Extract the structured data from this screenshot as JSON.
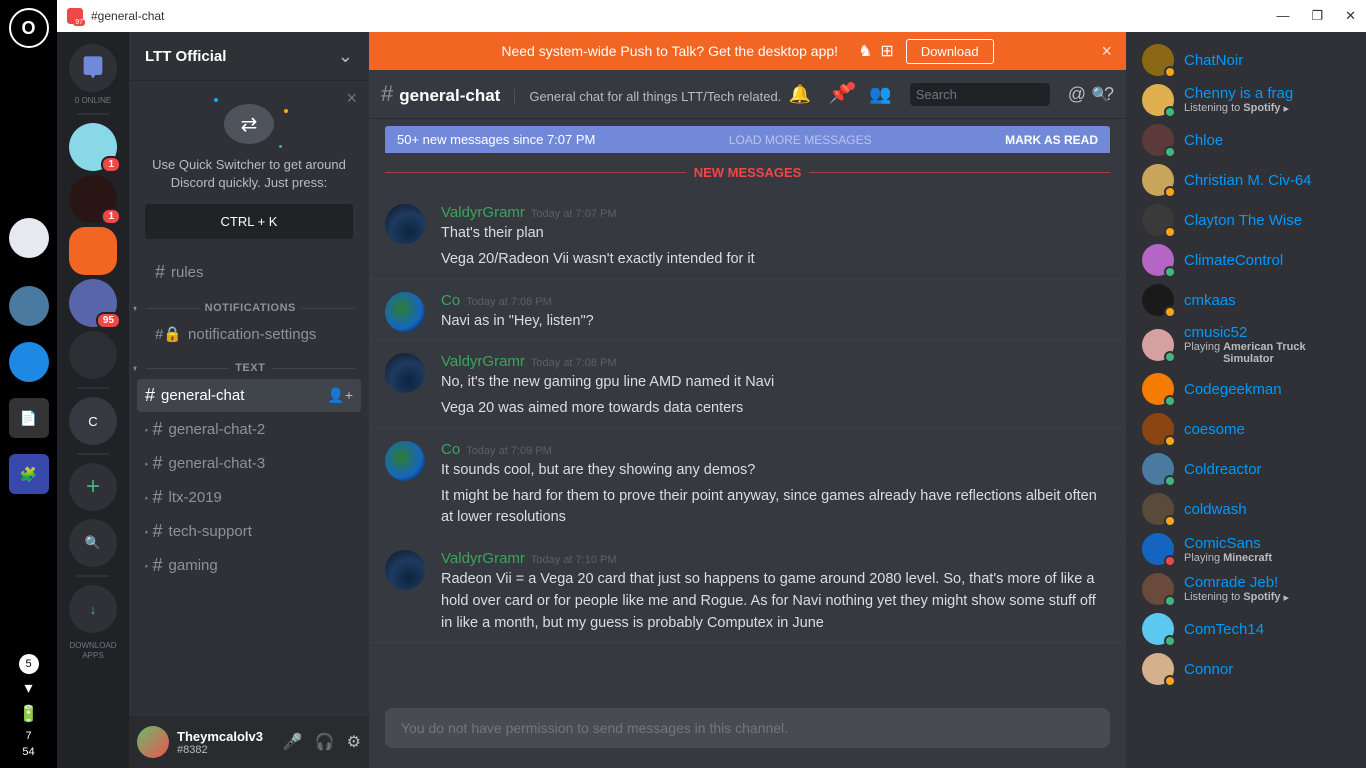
{
  "titlebar": {
    "text": "#general-chat",
    "badge": "97"
  },
  "os": {
    "stat1": "7",
    "stat2": "54",
    "badge5": "5"
  },
  "servers": {
    "online_label": "0 ONLINE",
    "download_label": "DOWNLOAD\nAPPS",
    "items": [
      {
        "badge": "1",
        "bg": "#88d8e8"
      },
      {
        "badge": "1",
        "bg": "#2a1515"
      },
      {
        "badge": "",
        "bg": "#f26522",
        "active": true
      },
      {
        "badge": "95",
        "bg": "#5865a8"
      },
      {
        "badge": "",
        "bg": "#36393f",
        "dim": true
      }
    ],
    "user_letter": "C"
  },
  "sidebar": {
    "server_name": "LTT Official",
    "qs": {
      "text": "Use Quick Switcher to get around Discord quickly. Just press:",
      "button": "CTRL + K"
    },
    "cat_rules": "rules",
    "cat_notifications_label": "NOTIFICATIONS",
    "notif_settings": "notification-settings",
    "cat_text_label": "TEXT",
    "channels": [
      {
        "name": "general-chat",
        "active": true
      },
      {
        "name": "general-chat-2"
      },
      {
        "name": "general-chat-3"
      },
      {
        "name": "ltx-2019"
      },
      {
        "name": "tech-support"
      },
      {
        "name": "gaming"
      }
    ]
  },
  "user": {
    "name": "Theymcalolv3",
    "tag": "#8382"
  },
  "banner": {
    "text": "Need system-wide Push to Talk? Get the desktop app!",
    "button": "Download"
  },
  "chat": {
    "title": "general-chat",
    "topic": "General chat for all things LTT/Tech related.",
    "search_placeholder": "Search",
    "new_bar": "50+ new messages since 7:07 PM",
    "load_more": "LOAD MORE MESSAGES",
    "mark_read": "MARK AS READ",
    "new_messages": "NEW MESSAGES",
    "input_placeholder": "You do not have permission to send messages in this channel."
  },
  "messages": [
    {
      "author": "ValdyrGramr",
      "color": "#3ba55c",
      "time": "Today at 7:07 PM",
      "avatar": "av-blue",
      "lines": [
        "That's their plan",
        "Vega 20/Radeon Vii wasn't exactly intended for it"
      ]
    },
    {
      "author": "Co",
      "color": "#3ba55c",
      "time": "Today at 7:08 PM",
      "avatar": "av-earth",
      "lines": [
        "Navi as in \"Hey, listen\"?"
      ]
    },
    {
      "author": "ValdyrGramr",
      "color": "#3ba55c",
      "time": "Today at 7:08 PM",
      "avatar": "av-blue",
      "lines": [
        "No, it's the new gaming gpu line AMD named it Navi",
        "Vega 20 was aimed more towards data centers"
      ]
    },
    {
      "author": "Co",
      "color": "#3ba55c",
      "time": "Today at 7:09 PM",
      "avatar": "av-earth",
      "lines": [
        "It sounds cool, but are they showing any demos?",
        "It might be hard for them to prove their point anyway, since games already have reflections albeit often at lower resolutions"
      ]
    },
    {
      "author": "ValdyrGramr",
      "color": "#3ba55c",
      "time": "Today at 7:10 PM",
      "avatar": "av-blue",
      "lines": [
        "Radeon Vii = a Vega 20 card that just so happens to game around 2080 level.  So, that's more of like a hold over card or for people like me and Rogue.  As for Navi nothing yet they might show some stuff off in like a month, but my guess is probably Computex in June"
      ]
    }
  ],
  "members": [
    {
      "name": "ChatNoir",
      "bg": "#8b6914",
      "status": "idle"
    },
    {
      "name": "Chenny is a frag",
      "bg": "#e0b050",
      "status": "online",
      "activity_prefix": "Listening to",
      "activity_name": "Spotify",
      "spotify": true
    },
    {
      "name": "Chloe",
      "bg": "#5d3a3a",
      "status": "online"
    },
    {
      "name": "Christian M. Civ-64",
      "bg": "#c9a55c",
      "status": "idle"
    },
    {
      "name": "Clayton The Wise",
      "bg": "#3a3a3a",
      "status": "idle"
    },
    {
      "name": "ClimateControl",
      "bg": "#b565c4",
      "status": "online"
    },
    {
      "name": "cmkaas",
      "bg": "#1a1a1a",
      "status": "idle"
    },
    {
      "name": "cmusic52",
      "bg": "#d4a0a0",
      "status": "online",
      "activity_prefix": "Playing",
      "activity_name": "American Truck Simulator"
    },
    {
      "name": "Codegeekman",
      "bg": "#f57c00",
      "status": "online"
    },
    {
      "name": "coesome",
      "bg": "#8b4513",
      "status": "idle"
    },
    {
      "name": "Coldreactor",
      "bg": "#4a7aa0",
      "status": "online"
    },
    {
      "name": "coldwash",
      "bg": "#5a4a3a",
      "status": "idle"
    },
    {
      "name": "ComicSans",
      "bg": "#1565c0",
      "status": "dnd",
      "activity_prefix": "Playing",
      "activity_name": "Minecraft"
    },
    {
      "name": "Comrade Jeb!",
      "bg": "#6a4a3a",
      "status": "online",
      "activity_prefix": "Listening to",
      "activity_name": "Spotify",
      "spotify": true
    },
    {
      "name": "ComTech14",
      "bg": "#5cc8f0",
      "status": "online"
    },
    {
      "name": "Connor",
      "bg": "#d4b08c",
      "status": "idle"
    }
  ]
}
